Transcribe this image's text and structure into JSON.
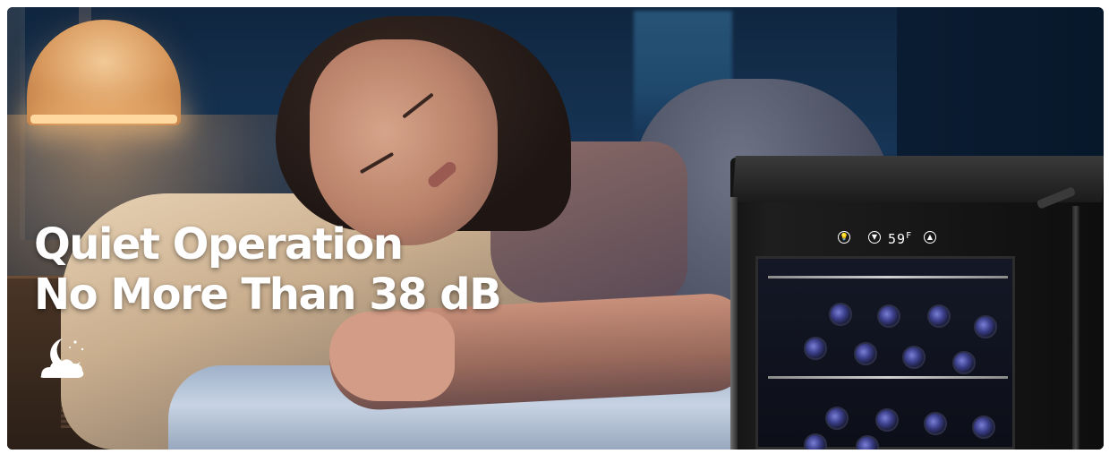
{
  "banner": {
    "headline_line1": "Quiet Operation",
    "headline_line2": "No More Than 38 dB",
    "icon": "moon-cloud-sleep-icon"
  },
  "wine_cooler": {
    "display_temperature": "59",
    "display_unit": "F",
    "buttons": [
      "light-icon",
      "down-arrow-icon",
      "up-arrow-icon"
    ]
  },
  "colors": {
    "headline": "#ffffff",
    "night_blue": "#0f2742",
    "lamp_glow": "#f2c996"
  }
}
